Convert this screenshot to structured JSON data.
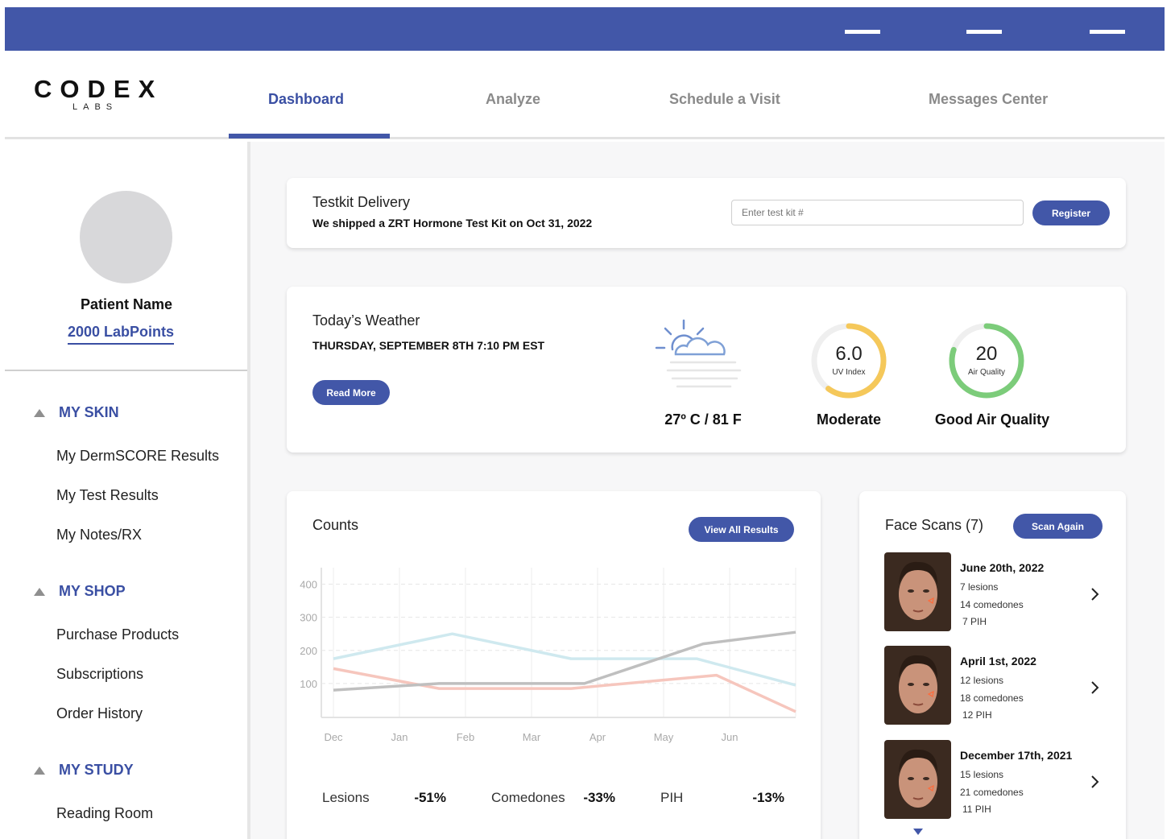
{
  "brand": {
    "line1": "CODEX",
    "line2": "LABS"
  },
  "nav": {
    "tabs": [
      {
        "label": "Dashboard"
      },
      {
        "label": "Analyze"
      },
      {
        "label": "Schedule a Visit"
      },
      {
        "label": "Messages Center"
      }
    ],
    "active_tab": "Dashboard"
  },
  "sidebar": {
    "patient_name": "Patient Name",
    "labpoints": "2000 LabPoints",
    "sections": [
      {
        "title": "MY SKIN",
        "items": [
          "My DermSCORE  Results",
          "My Test Results",
          "My Notes/RX"
        ]
      },
      {
        "title": "MY SHOP",
        "items": [
          "Purchase Products",
          "Subscriptions",
          "Order History"
        ]
      },
      {
        "title": "MY STUDY",
        "items": [
          "Reading Room"
        ]
      }
    ]
  },
  "testkit": {
    "title": "Testkit Delivery",
    "message": "We shipped a ZRT Hormone Test Kit on Oct 31, 2022",
    "input_placeholder": "Enter test kit #",
    "register_label": "Register"
  },
  "weather": {
    "title": "Today’s Weather",
    "datetime": "THURSDAY, SEPTEMBER 8TH  7:10 PM EST",
    "read_more_label": "Read More",
    "temperature": "27º C / 81 F",
    "uv": {
      "value": "6.0",
      "label": "UV Index",
      "caption": "Moderate",
      "fraction": 0.6,
      "color": "#f5c85a"
    },
    "air": {
      "value": "20",
      "label": "Air Quality",
      "caption": "Good Air Quality",
      "fraction": 0.8,
      "color": "#7ccc7a"
    }
  },
  "counts": {
    "title": "Counts",
    "view_all_label": "View All Results",
    "summary": [
      {
        "label": "Lesions",
        "value": "-51%",
        "color": "#cfe9ec"
      },
      {
        "label": "Comedones",
        "value": "-33%",
        "color": "#c4c4c4"
      },
      {
        "label": "PIH",
        "value": "-13%",
        "color": "#f7cfc7"
      }
    ]
  },
  "chart_data": {
    "type": "line",
    "categories": [
      "Dec",
      "Jan",
      "Feb",
      "Mar",
      "Apr",
      "May",
      "Jun"
    ],
    "y_ticks": [
      100,
      200,
      300,
      400
    ],
    "ylim": [
      0,
      450
    ],
    "grid": true,
    "series": [
      {
        "color": "#cfe9ef",
        "points": [
          [
            0,
            175
          ],
          [
            1.8,
            250
          ],
          [
            3.6,
            175
          ],
          [
            5.5,
            175
          ],
          [
            7.0,
            95
          ]
        ]
      },
      {
        "color": "#f6c6bd",
        "points": [
          [
            0,
            145
          ],
          [
            1.6,
            85
          ],
          [
            3.6,
            85
          ],
          [
            5.8,
            125
          ],
          [
            7.0,
            15
          ]
        ]
      },
      {
        "color": "#bfbfbf",
        "points": [
          [
            0,
            80
          ],
          [
            1.6,
            100
          ],
          [
            3.8,
            100
          ],
          [
            5.6,
            220
          ],
          [
            7.0,
            255
          ]
        ]
      }
    ]
  },
  "face_scans": {
    "title": "Face Scans (7)",
    "scan_again_label": "Scan Again",
    "items": [
      {
        "date": "June 20th, 2022",
        "lesions": "7 lesions",
        "comedones": "14 comedones",
        "pih": "7 PIH"
      },
      {
        "date": "April 1st, 2022",
        "lesions": "12 lesions",
        "comedones": "18 comedones",
        "pih": "12 PIH"
      },
      {
        "date": "December 17th, 2021",
        "lesions": "15 lesions",
        "comedones": "21 comedones",
        "pih": "11 PIH"
      }
    ]
  },
  "colors": {
    "primary": "#4257a8",
    "accent_text": "#3a4fa3"
  }
}
